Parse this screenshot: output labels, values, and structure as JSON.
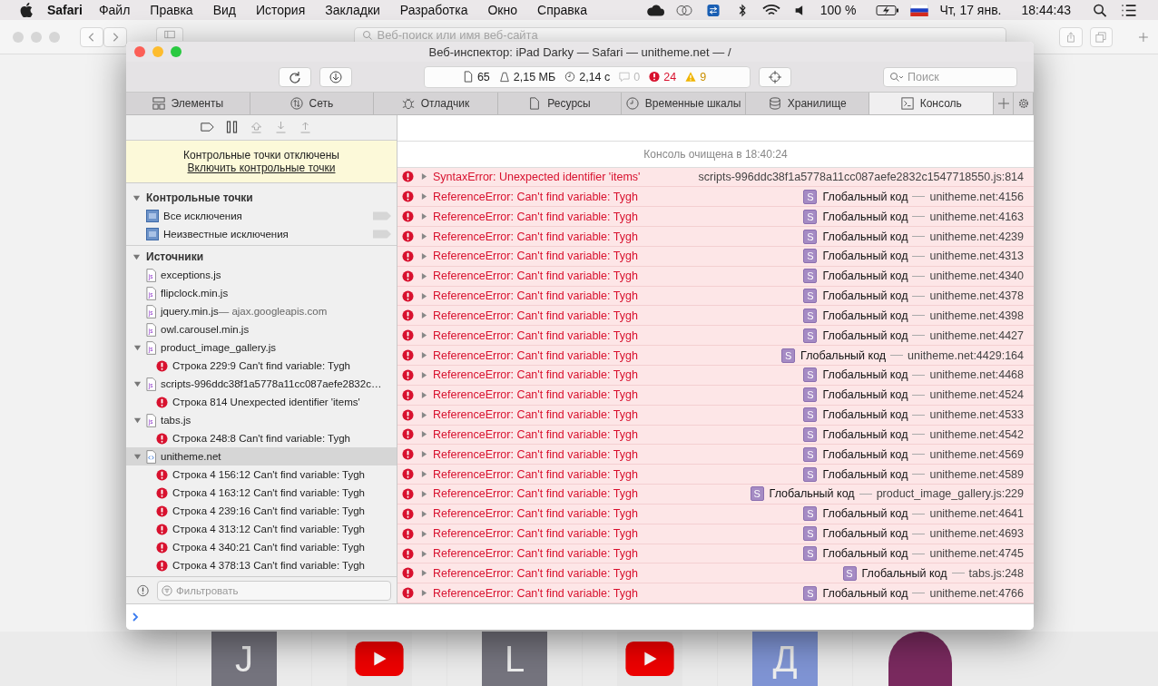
{
  "menubar": {
    "app": "Safari",
    "menus": [
      "Файл",
      "Правка",
      "Вид",
      "История",
      "Закладки",
      "Разработка",
      "Окно",
      "Справка"
    ],
    "battery": "100 %",
    "date": "Чт, 17 янв.",
    "time": "18:44:43"
  },
  "browser": {
    "address_placeholder": "Веб-поиск или имя веб-сайта"
  },
  "favorites": [
    {
      "kind": "letter",
      "text": "J",
      "color": "#75747e"
    },
    {
      "kind": "video"
    },
    {
      "kind": "letter",
      "text": "L",
      "color": "#75747e"
    },
    {
      "kind": "video"
    },
    {
      "kind": "letter",
      "text": "Д",
      "color": "#7f94d4"
    },
    {
      "kind": "avatar"
    }
  ],
  "inspector": {
    "title": "Веб-инспектор: iPad Darky — Safari — unitheme.net — /",
    "stats": {
      "resources": "65",
      "size": "2,15 МБ",
      "time": "2,14 с",
      "logs": "0",
      "errors": "24",
      "warnings": "9"
    },
    "search_placeholder": "Поиск",
    "tabs": [
      {
        "label": "Элементы",
        "selected": false
      },
      {
        "label": "Сеть",
        "selected": false
      },
      {
        "label": "Отладчик",
        "selected": false
      },
      {
        "label": "Ресурсы",
        "selected": false
      },
      {
        "label": "Временные шкалы",
        "selected": false
      },
      {
        "label": "Хранилище",
        "selected": false
      },
      {
        "label": "Консоль",
        "selected": true
      }
    ],
    "banner": {
      "text": "Контрольные точки отключены",
      "link": "Включить контрольные точки"
    },
    "breakpoints": {
      "title": "Контрольные точки",
      "items": [
        "Все исключения",
        "Неизвестные исключения"
      ]
    },
    "sources": {
      "title": "Источники",
      "items": [
        {
          "kind": "js",
          "name": "exceptions.js",
          "selected": false
        },
        {
          "kind": "js",
          "name": "flipclock.min.js",
          "selected": false
        },
        {
          "kind": "js",
          "name": "jquery.min.js",
          "domain": "— ajax.googleapis.com",
          "selected": false
        },
        {
          "kind": "js",
          "name": "owl.carousel.min.js",
          "selected": false
        },
        {
          "kind": "js",
          "name": "product_image_gallery.js",
          "expanded": true,
          "selected": false,
          "children": [
            {
              "kind": "error",
              "name": "Строка 229:9 Can't find variable: Tygh",
              "selected": false
            }
          ]
        },
        {
          "kind": "js",
          "name": "scripts-996ddc38f1a5778a11cc087aefe2832c…",
          "expanded": true,
          "selected": false,
          "children": [
            {
              "kind": "error",
              "name": "Строка 814 Unexpected identifier 'items'",
              "selected": false
            }
          ]
        },
        {
          "kind": "js",
          "name": "tabs.js",
          "expanded": true,
          "selected": false,
          "children": [
            {
              "kind": "error",
              "name": "Строка 248:8 Can't find variable: Tygh",
              "selected": false
            }
          ]
        },
        {
          "kind": "html",
          "name": "unitheme.net",
          "expanded": true,
          "selected": true,
          "children": [
            {
              "kind": "error",
              "name": "Строка 4 156:12 Can't find variable: Tygh",
              "selected": false
            },
            {
              "kind": "error",
              "name": "Строка 4 163:12 Can't find variable: Tygh",
              "selected": false
            },
            {
              "kind": "error",
              "name": "Строка 4 239:16 Can't find variable: Tygh",
              "selected": false
            },
            {
              "kind": "error",
              "name": "Строка 4 313:12 Can't find variable: Tygh",
              "selected": false
            },
            {
              "kind": "error",
              "name": "Строка 4 340:21 Can't find variable: Tygh",
              "selected": false
            },
            {
              "kind": "error",
              "name": "Строка 4 378:13 Can't find variable: Tygh",
              "selected": false
            }
          ]
        }
      ]
    },
    "filter_placeholder": "Фильтровать",
    "console": {
      "cleared": "Консоль очищена в 18:40:24",
      "rows": [
        {
          "message": "SyntaxError: Unexpected identifier 'items'",
          "location": "scripts-996ddc38f1a5778a11cc087aefe2832c1547718550.js:814"
        },
        {
          "message": "ReferenceError: Can't find variable: Tygh",
          "badge": "S",
          "function": "Глобальный код",
          "location": "unitheme.net:4156"
        },
        {
          "message": "ReferenceError: Can't find variable: Tygh",
          "badge": "S",
          "function": "Глобальный код",
          "location": "unitheme.net:4163"
        },
        {
          "message": "ReferenceError: Can't find variable: Tygh",
          "badge": "S",
          "function": "Глобальный код",
          "location": "unitheme.net:4239"
        },
        {
          "message": "ReferenceError: Can't find variable: Tygh",
          "badge": "S",
          "function": "Глобальный код",
          "location": "unitheme.net:4313"
        },
        {
          "message": "ReferenceError: Can't find variable: Tygh",
          "badge": "S",
          "function": "Глобальный код",
          "location": "unitheme.net:4340"
        },
        {
          "message": "ReferenceError: Can't find variable: Tygh",
          "badge": "S",
          "function": "Глобальный код",
          "location": "unitheme.net:4378"
        },
        {
          "message": "ReferenceError: Can't find variable: Tygh",
          "badge": "S",
          "function": "Глобальный код",
          "location": "unitheme.net:4398"
        },
        {
          "message": "ReferenceError: Can't find variable: Tygh",
          "badge": "S",
          "function": "Глобальный код",
          "location": "unitheme.net:4427"
        },
        {
          "message": "ReferenceError: Can't find variable: Tygh",
          "badge": "S",
          "function": "Глобальный код",
          "location": "unitheme.net:4429:164"
        },
        {
          "message": "ReferenceError: Can't find variable: Tygh",
          "badge": "S",
          "function": "Глобальный код",
          "location": "unitheme.net:4468"
        },
        {
          "message": "ReferenceError: Can't find variable: Tygh",
          "badge": "S",
          "function": "Глобальный код",
          "location": "unitheme.net:4524"
        },
        {
          "message": "ReferenceError: Can't find variable: Tygh",
          "badge": "S",
          "function": "Глобальный код",
          "location": "unitheme.net:4533"
        },
        {
          "message": "ReferenceError: Can't find variable: Tygh",
          "badge": "S",
          "function": "Глобальный код",
          "location": "unitheme.net:4542"
        },
        {
          "message": "ReferenceError: Can't find variable: Tygh",
          "badge": "S",
          "function": "Глобальный код",
          "location": "unitheme.net:4569"
        },
        {
          "message": "ReferenceError: Can't find variable: Tygh",
          "badge": "S",
          "function": "Глобальный код",
          "location": "unitheme.net:4589"
        },
        {
          "message": "ReferenceError: Can't find variable: Tygh",
          "badge": "S",
          "function": "Глобальный код",
          "location": "product_image_gallery.js:229"
        },
        {
          "message": "ReferenceError: Can't find variable: Tygh",
          "badge": "S",
          "function": "Глобальный код",
          "location": "unitheme.net:4641"
        },
        {
          "message": "ReferenceError: Can't find variable: Tygh",
          "badge": "S",
          "function": "Глобальный код",
          "location": "unitheme.net:4693"
        },
        {
          "message": "ReferenceError: Can't find variable: Tygh",
          "badge": "S",
          "function": "Глобальный код",
          "location": "unitheme.net:4745"
        },
        {
          "message": "ReferenceError: Can't find variable: Tygh",
          "badge": "S",
          "function": "Глобальный код",
          "location": "tabs.js:248"
        },
        {
          "message": "ReferenceError: Can't find variable: Tygh",
          "badge": "S",
          "function": "Глобальный код",
          "location": "unitheme.net:4766"
        }
      ]
    }
  }
}
